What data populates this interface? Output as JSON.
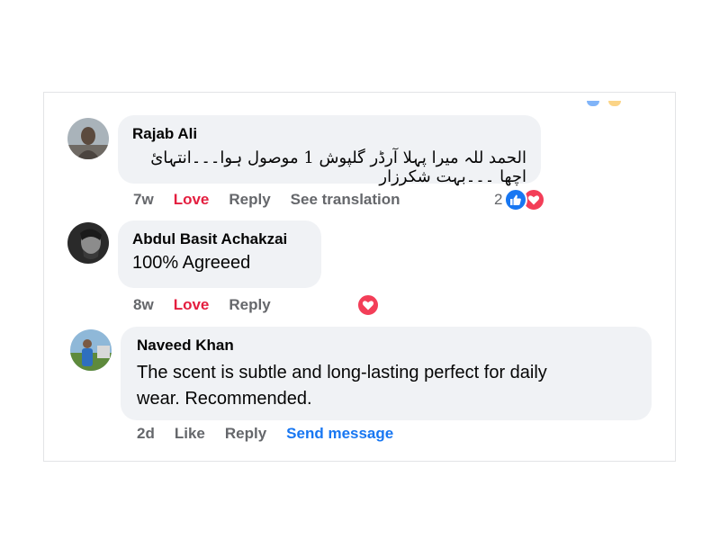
{
  "colors": {
    "love": "#e41e3f",
    "link": "#1877f2",
    "muted": "#65676b",
    "bubble": "#f0f2f5"
  },
  "comments": [
    {
      "author": "Rajab Ali",
      "text": "الحمد للہ میرا پہلا آرڈر گلپوش 1 موصول ہوا۔۔۔انتہائ اچھا ۔۔۔بہت شکرزار",
      "time": "7w",
      "reaction_action": "Love",
      "reply": "Reply",
      "extra": "See translation",
      "reaction_count": "2",
      "reaction_icons": [
        "like-icon",
        "love-icon"
      ]
    },
    {
      "author": "Abdul Basit Achakzai",
      "text": "100% Agreeed",
      "time": "8w",
      "reaction_action": "Love",
      "reply": "Reply",
      "reaction_icons": [
        "love-icon"
      ]
    },
    {
      "author": "Naveed Khan",
      "text_line1": "The scent is subtle and long-lasting perfect for daily",
      "text_line2": "wear. Recommended.",
      "time": "2d",
      "reaction_action": "Like",
      "reply": "Reply",
      "extra": "Send message"
    }
  ]
}
